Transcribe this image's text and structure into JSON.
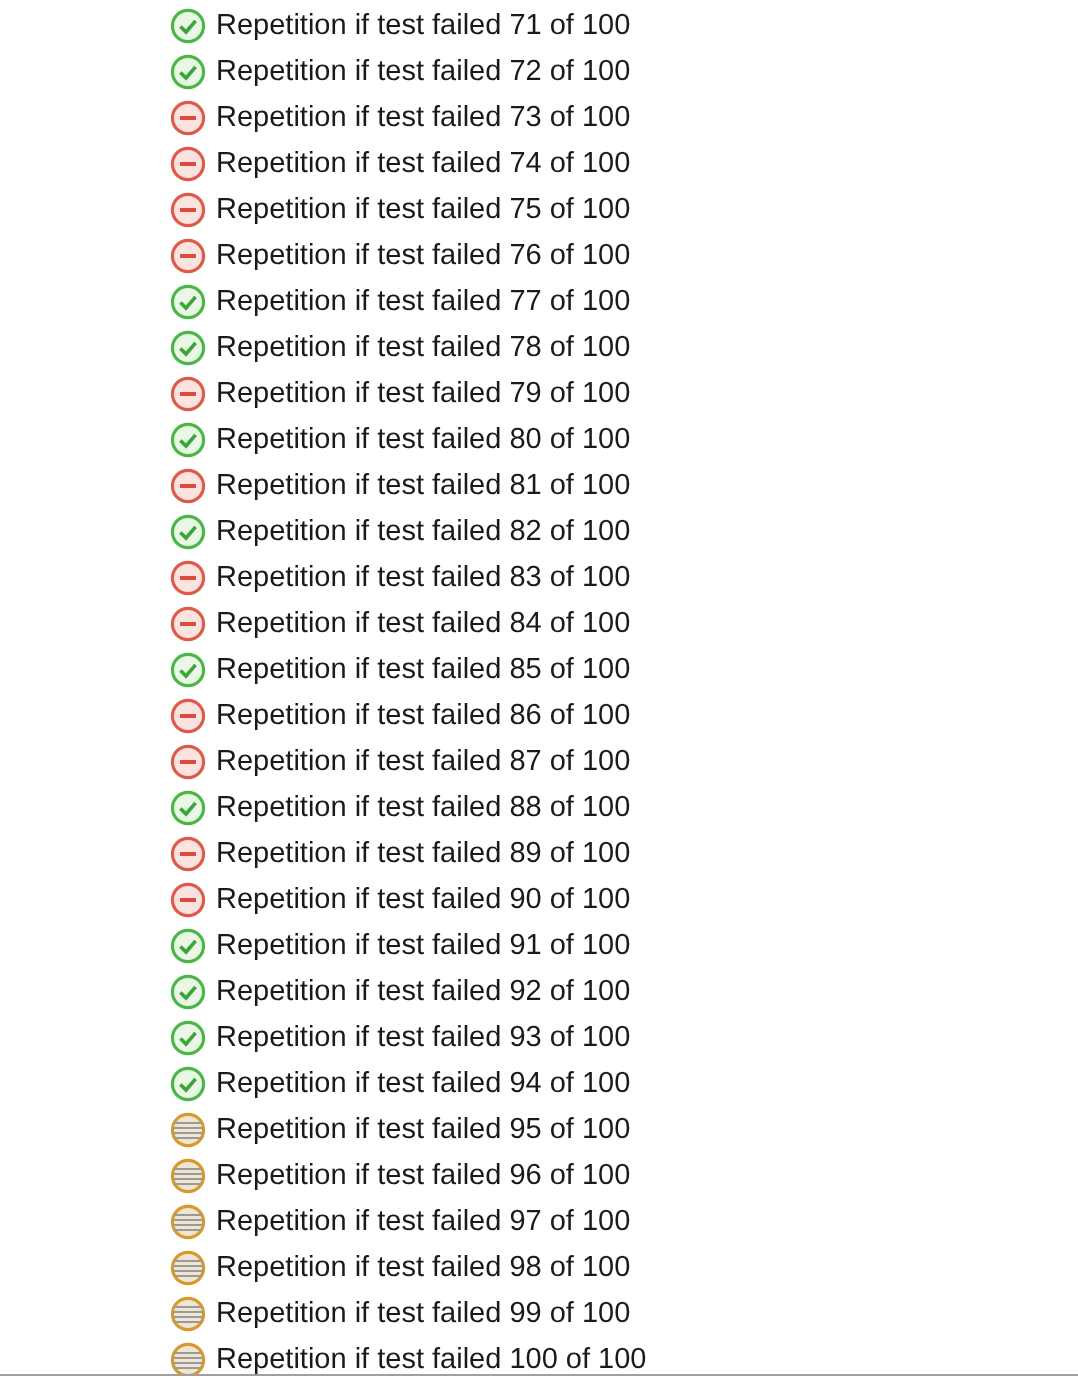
{
  "results": [
    {
      "label": "Repetition if test failed 71 of 100",
      "kind": "passed"
    },
    {
      "label": "Repetition if test failed 72 of 100",
      "kind": "passed"
    },
    {
      "label": "Repetition if test failed 73 of 100",
      "kind": "failed"
    },
    {
      "label": "Repetition if test failed 74 of 100",
      "kind": "failed"
    },
    {
      "label": "Repetition if test failed 75 of 100",
      "kind": "failed"
    },
    {
      "label": "Repetition if test failed 76 of 100",
      "kind": "failed"
    },
    {
      "label": "Repetition if test failed 77 of 100",
      "kind": "passed"
    },
    {
      "label": "Repetition if test failed 78 of 100",
      "kind": "passed"
    },
    {
      "label": "Repetition if test failed 79 of 100",
      "kind": "failed"
    },
    {
      "label": "Repetition if test failed 80 of 100",
      "kind": "passed"
    },
    {
      "label": "Repetition if test failed 81 of 100",
      "kind": "failed"
    },
    {
      "label": "Repetition if test failed 82 of 100",
      "kind": "passed"
    },
    {
      "label": "Repetition if test failed 83 of 100",
      "kind": "failed"
    },
    {
      "label": "Repetition if test failed 84 of 100",
      "kind": "failed"
    },
    {
      "label": "Repetition if test failed 85 of 100",
      "kind": "passed"
    },
    {
      "label": "Repetition if test failed 86 of 100",
      "kind": "failed"
    },
    {
      "label": "Repetition if test failed 87 of 100",
      "kind": "failed"
    },
    {
      "label": "Repetition if test failed 88 of 100",
      "kind": "passed"
    },
    {
      "label": "Repetition if test failed 89 of 100",
      "kind": "failed"
    },
    {
      "label": "Repetition if test failed 90 of 100",
      "kind": "failed"
    },
    {
      "label": "Repetition if test failed 91 of 100",
      "kind": "passed"
    },
    {
      "label": "Repetition if test failed 92 of 100",
      "kind": "passed"
    },
    {
      "label": "Repetition if test failed 93 of 100",
      "kind": "passed"
    },
    {
      "label": "Repetition if test failed 94 of 100",
      "kind": "passed"
    },
    {
      "label": "Repetition if test failed 95 of 100",
      "kind": "pending"
    },
    {
      "label": "Repetition if test failed 96 of 100",
      "kind": "pending"
    },
    {
      "label": "Repetition if test failed 97 of 100",
      "kind": "pending"
    },
    {
      "label": "Repetition if test failed 98 of 100",
      "kind": "pending"
    },
    {
      "label": "Repetition if test failed 99 of 100",
      "kind": "pending"
    },
    {
      "label": "Repetition if test failed 100 of 100",
      "kind": "pending"
    }
  ]
}
